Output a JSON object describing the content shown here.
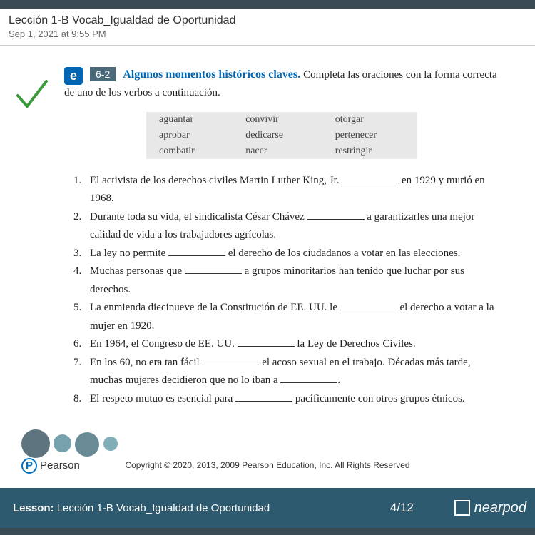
{
  "header": {
    "title": "Lección 1-B Vocab_Igualdad de Oportunidad",
    "date": "Sep 1, 2021 at 9:55 PM"
  },
  "exercise": {
    "icon": "e",
    "number": "6-2",
    "title": "Algunos momentos históricos claves.",
    "instructions": "Completa las oraciones con la forma correcta de uno de los verbos a continuación."
  },
  "wordbank": {
    "col1": [
      "aguantar",
      "aprobar",
      "combatir"
    ],
    "col2": [
      "convivir",
      "dedicarse",
      "nacer"
    ],
    "col3": [
      "otorgar",
      "pertenecer",
      "restringir"
    ]
  },
  "questions": [
    {
      "pre": "El activista de los derechos civiles Martin Luther King, Jr. ",
      "post": " en 1929 y murió en 1968."
    },
    {
      "pre": "Durante toda su vida, el sindicalista César Chávez ",
      "post": " a garantizarles una mejor calidad de vida a los trabajadores agrícolas."
    },
    {
      "pre": "La ley no permite ",
      "post": " el derecho de los ciudadanos a votar en las elecciones."
    },
    {
      "pre": "Muchas personas que ",
      "post": " a grupos minoritarios han tenido que luchar por sus derechos."
    },
    {
      "pre": "La enmienda diecinueve de la Constitución de EE. UU. le ",
      "post": " el derecho a votar a la mujer en 1920."
    },
    {
      "pre": "En 1964, el Congreso de EE. UU. ",
      "post": " la Ley de Derechos Civiles."
    },
    {
      "pre": "En los 60, no era tan fácil ",
      "post": " el acoso sexual en el trabajo. Décadas más tarde, muchas mujeres decidieron que no lo iban a ",
      "post2": "."
    },
    {
      "pre": "El respeto mutuo es esencial para ",
      "post": " pacíficamente con otros grupos étnicos."
    }
  ],
  "footer": {
    "publisher": "Pearson",
    "copyright": "Copyright © 2020, 2013, 2009 Pearson Education, Inc. All Rights Reserved"
  },
  "bottom": {
    "label": "Lesson:",
    "name": "Lección 1-B Vocab_Igualdad de Oportunidad",
    "page": "4/12",
    "brand": "nearpod"
  }
}
